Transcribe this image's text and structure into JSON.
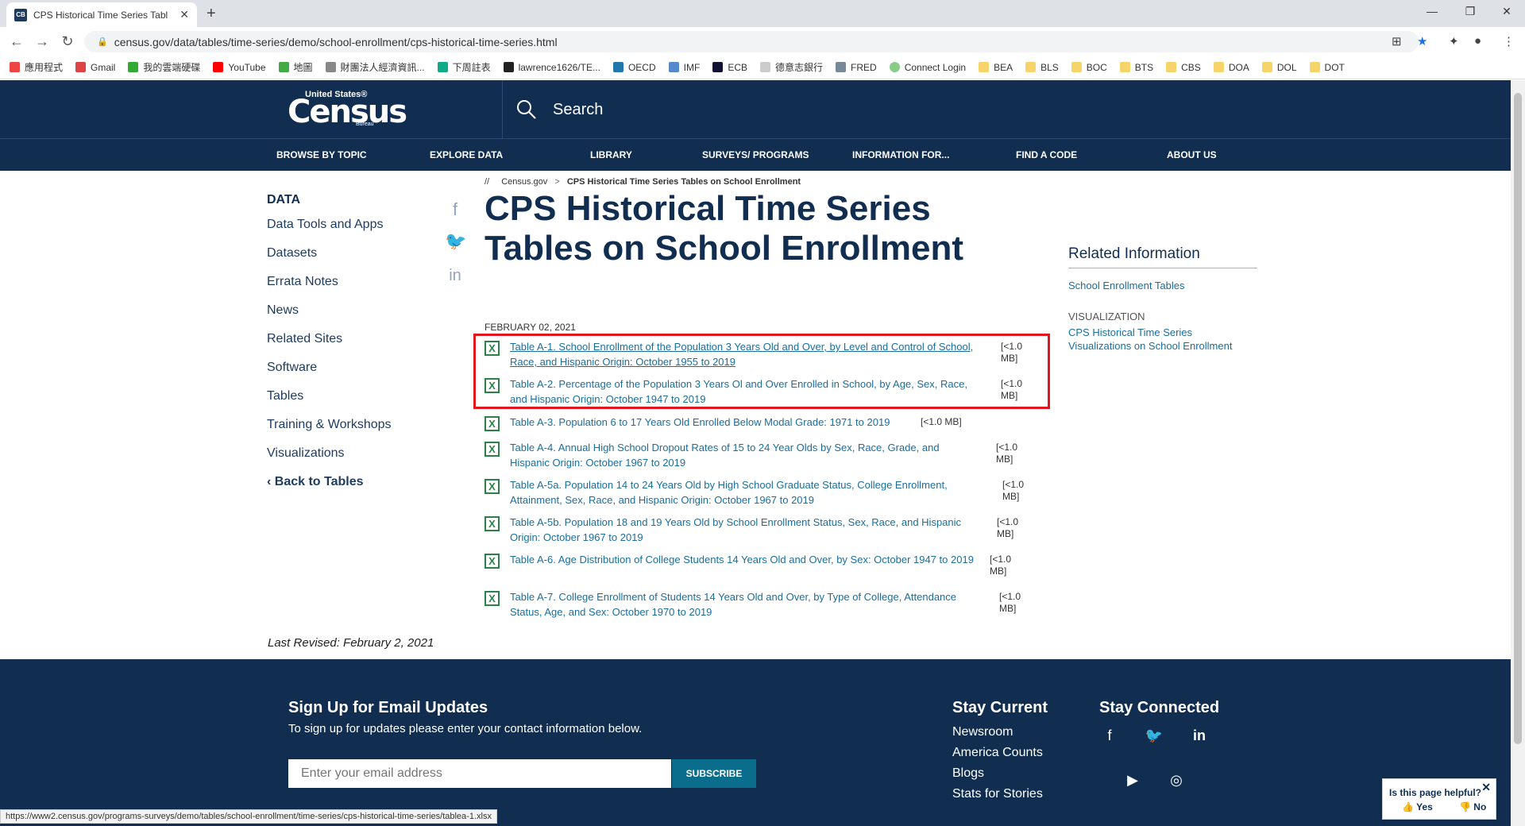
{
  "browser": {
    "tab_title": "CPS Historical Time Series Tabl",
    "tab_icon": "CB",
    "url": "census.gov/data/tables/time-series/demo/school-enrollment/cps-historical-time-series.html",
    "bookmarks": [
      "應用程式",
      "Gmail",
      "我的雲端硬碟",
      "YouTube",
      "地圖",
      "財團法人經濟資訊...",
      "下周註表",
      "lawrence1626/TE...",
      "OECD",
      "IMF",
      "ECB",
      "德意志銀行",
      "FRED",
      "Connect Login",
      "BEA",
      "BLS",
      "BOC",
      "BTS",
      "CBS",
      "DOA",
      "DOL",
      "DOT"
    ],
    "status_url": "https://www2.census.gov/programs-surveys/demo/tables/school-enrollment/time-series/cps-historical-time-series/tablea-1.xlsx"
  },
  "header": {
    "logo_us": "United States®",
    "logo_census": "Census",
    "logo_bureau": "Bureau",
    "search_label": "Search",
    "nav": [
      "BROWSE BY TOPIC",
      "EXPLORE DATA",
      "LIBRARY",
      "SURVEYS/ PROGRAMS",
      "INFORMATION FOR...",
      "FIND A CODE",
      "ABOUT US"
    ]
  },
  "breadcrumb": {
    "root": "//",
    "home": "Census.gov",
    "arrow": ">",
    "current": "CPS Historical Time Series Tables on School Enrollment"
  },
  "sidebar": {
    "heading": "DATA",
    "items": [
      "Data Tools and Apps",
      "Datasets",
      "Errata Notes",
      "News",
      "Related Sites",
      "Software",
      "Tables",
      "Training & Workshops",
      "Visualizations"
    ],
    "back": "Back to Tables"
  },
  "main": {
    "title": "CPS Historical Time Series Tables on School Enrollment",
    "date": "FEBRUARY 02, 2021",
    "tables": [
      {
        "text": "Table A-1. School Enrollment of the Population 3 Years Old and Over, by Level and Control of School, Race, and Hispanic Origin: October 1955 to 2019",
        "size": "[<1.0 MB]"
      },
      {
        "text": "Table A-2. Percentage of the Population 3 Years Ol and Over Enrolled in School, by Age, Sex, Race, and Hispanic Origin: October 1947 to 2019",
        "size": "[<1.0 MB]"
      },
      {
        "text": "Table A-3. Population 6 to 17 Years Old Enrolled Below Modal Grade: 1971 to 2019",
        "size": "[<1.0 MB]"
      },
      {
        "text": "Table A-4. Annual High School Dropout Rates of 15 to 24 Year Olds by Sex, Race, Grade, and Hispanic Origin: October 1967 to 2019",
        "size": "[<1.0 MB]"
      },
      {
        "text": "Table A-5a. Population 14 to 24 Years Old by High School Graduate Status, College Enrollment, Attainment, Sex, Race, and Hispanic Origin: October 1967 to 2019",
        "size": "[<1.0 MB]"
      },
      {
        "text": "Table A-5b. Population 18 and 19 Years Old by School Enrollment Status, Sex, Race, and Hispanic Origin: October 1967 to 2019",
        "size": "[<1.0 MB]"
      },
      {
        "text": "Table A-6. Age Distribution of College Students 14 Years Old and Over, by Sex: October 1947 to 2019",
        "size": "[<1.0 MB]"
      },
      {
        "text": "Table A-7. College Enrollment of Students 14 Years Old and Over, by Type of College, Attendance Status, Age, and Sex: October 1970 to 2019",
        "size": "[<1.0 MB]"
      }
    ],
    "revised": "Last Revised: February 2, 2021"
  },
  "related": {
    "heading": "Related Information",
    "link1": "School Enrollment Tables",
    "section": "VISUALIZATION",
    "link2": "CPS Historical Time Series Visualizations on School Enrollment"
  },
  "footer": {
    "signup_heading": "Sign Up for Email Updates",
    "signup_text": "To sign up for updates please enter your contact information below.",
    "email_placeholder": "Enter your email address",
    "subscribe": "SUBSCRIBE",
    "stay_current": "Stay Current",
    "current_links": [
      "Newsroom",
      "America Counts",
      "Blogs",
      "Stats for Stories"
    ],
    "stay_connected": "Stay Connected"
  },
  "feedback": {
    "question": "Is this page helpful?",
    "yes": "Yes",
    "no": "No"
  },
  "colors": {
    "navy": "#112e51",
    "link": "#1a6e9e",
    "excel": "#2a8246",
    "highlight": "#e0171f"
  }
}
